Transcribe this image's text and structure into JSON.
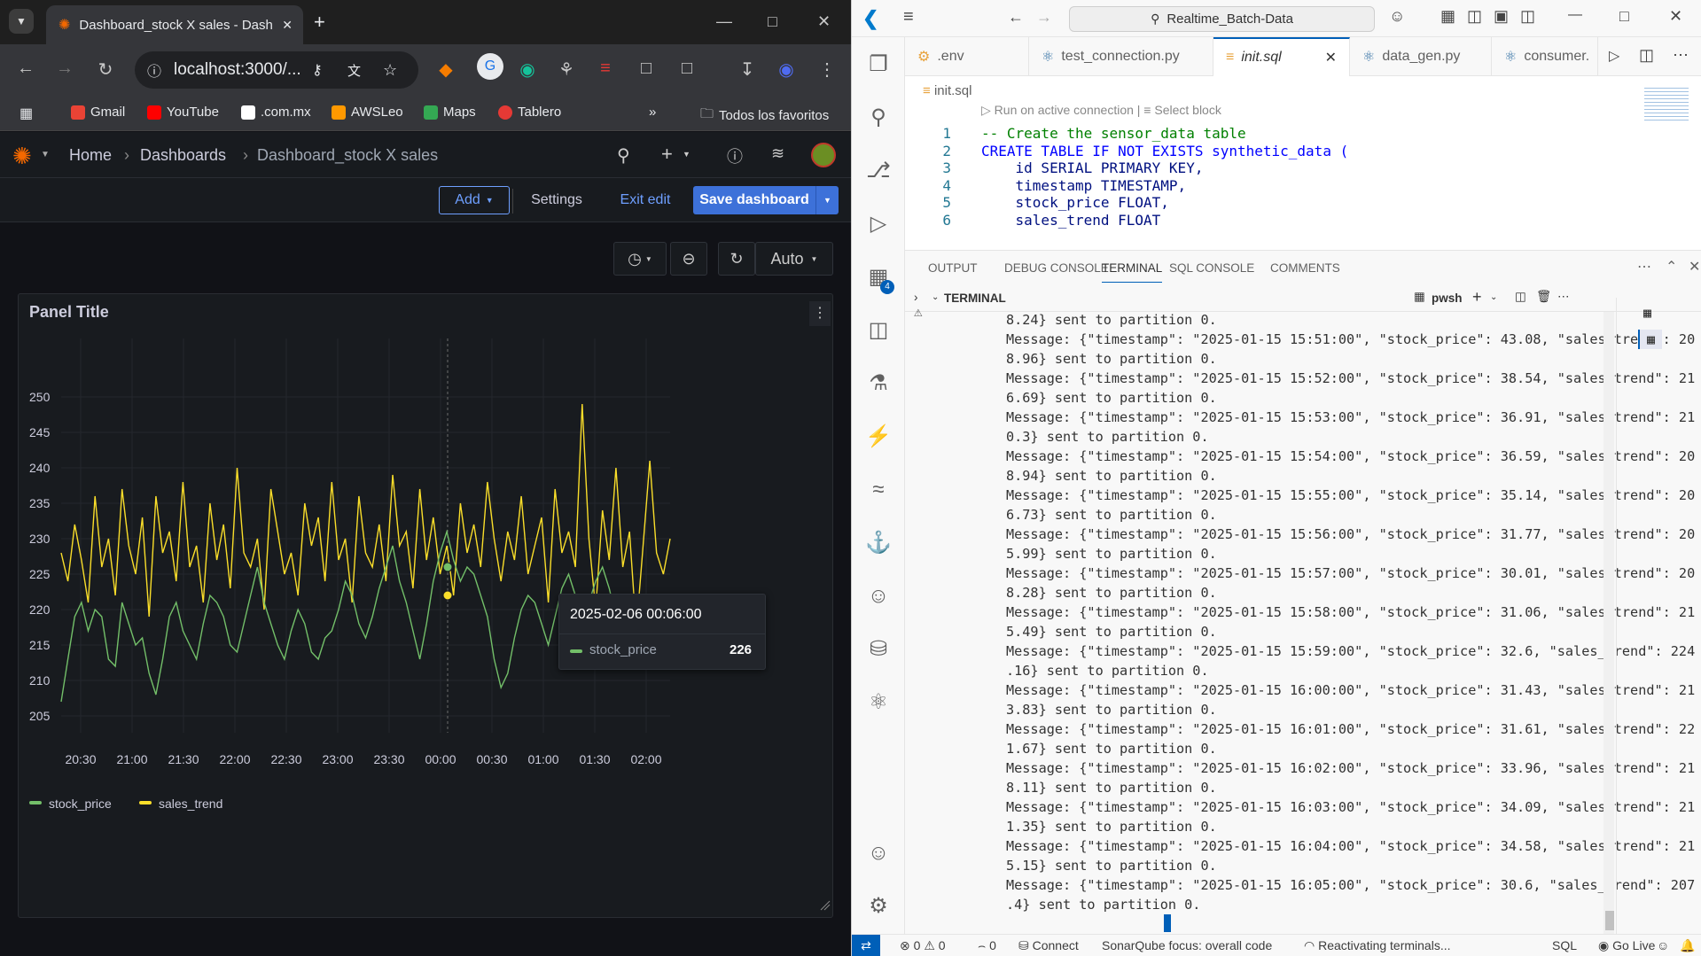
{
  "browser": {
    "tab_title": "Dashboard_stock X sales - Dash",
    "url": "localhost:3000/...",
    "bookmarks": [
      "Gmail",
      "YouTube",
      ".com.mx",
      "AWSLeo",
      "Maps",
      "Tablero"
    ],
    "all_bookmarks": "Todos los favoritos"
  },
  "grafana": {
    "breadcrumbs": [
      "Home",
      "Dashboards",
      "Dashboard_stock X sales"
    ],
    "add_label": "Add",
    "settings_label": "Settings",
    "exit_edit_label": "Exit edit",
    "save_label": "Save dashboard",
    "refresh_label": "Auto",
    "panel_title": "Panel Title",
    "tooltip": {
      "time": "2025-02-06 00:06:00",
      "series": "stock_price",
      "value": "226"
    }
  },
  "chart_data": {
    "type": "line",
    "x_ticks": [
      "20:30",
      "21:00",
      "21:30",
      "22:00",
      "22:30",
      "23:00",
      "23:30",
      "00:00",
      "00:30",
      "01:00",
      "01:30",
      "02:00"
    ],
    "y_ticks": [
      205,
      210,
      215,
      220,
      225,
      230,
      235,
      240,
      245,
      250
    ],
    "ylim": [
      203,
      253
    ],
    "legend_position": "bottom-left",
    "series": [
      {
        "name": "stock_price",
        "color": "#73bf69",
        "values": [
          207,
          213,
          219,
          221,
          217,
          220,
          219,
          213,
          212,
          221,
          218,
          215,
          216,
          211,
          208,
          213,
          219,
          221,
          217,
          215,
          213,
          218,
          222,
          221,
          219,
          215,
          214,
          218,
          222,
          226,
          221,
          218,
          215,
          213,
          217,
          220,
          218,
          214,
          213,
          216,
          217,
          220,
          224,
          222,
          218,
          216,
          219,
          223,
          226,
          229,
          224,
          221,
          217,
          213,
          218,
          224,
          228,
          231,
          227,
          224,
          226,
          225,
          222,
          219,
          213,
          209,
          211,
          216,
          220,
          222,
          221,
          218,
          215,
          219,
          223,
          225,
          222,
          218,
          221,
          224,
          226,
          223,
          219,
          221,
          218,
          220,
          215,
          214,
          212,
          215,
          216
        ]
      },
      {
        "name": "sales_trend",
        "color": "#fade2a",
        "values": [
          228,
          224,
          232,
          227,
          221,
          236,
          226,
          230,
          222,
          237,
          229,
          225,
          233,
          219,
          236,
          228,
          231,
          224,
          238,
          226,
          229,
          221,
          235,
          227,
          232,
          223,
          240,
          228,
          226,
          230,
          220,
          237,
          231,
          225,
          228,
          222,
          235,
          229,
          233,
          224,
          238,
          227,
          230,
          221,
          236,
          228,
          226,
          232,
          224,
          239,
          229,
          231,
          223,
          237,
          227,
          233,
          225,
          229,
          222,
          235,
          228,
          232,
          226,
          238,
          230,
          224,
          231,
          227,
          236,
          225,
          229,
          233,
          221,
          237,
          228,
          231,
          226,
          249,
          230,
          220,
          234,
          227,
          240,
          226,
          231,
          217,
          229,
          241,
          228,
          225,
          230
        ]
      }
    ]
  },
  "vscode": {
    "command_center": "Realtime_Batch-Data",
    "tabs": [
      ".env",
      "test_connection.py",
      "init.sql",
      "data_gen.py",
      "consumer."
    ],
    "breadcrumb": "init.sql",
    "codelens": "Run on active connection | ≡ Select block",
    "code": [
      {
        "n": "1",
        "text": "-- Create the sensor_data table"
      },
      {
        "n": "2",
        "text": "CREATE TABLE IF NOT EXISTS synthetic_data ("
      },
      {
        "n": "3",
        "text": "    id SERIAL PRIMARY KEY,"
      },
      {
        "n": "4",
        "text": "    timestamp TIMESTAMP,"
      },
      {
        "n": "5",
        "text": "    stock_price FLOAT,"
      },
      {
        "n": "6",
        "text": "    sales_trend FLOAT"
      }
    ],
    "panel_tabs": [
      "OUTPUT",
      "DEBUG CONSOLE",
      "TERMINAL",
      "SQL CONSOLE",
      "COMMENTS"
    ],
    "terminal_title": "TERMINAL",
    "shell": "pwsh",
    "terminal_lines": [
      "8.24} sent to partition 0.",
      "Message: {\"timestamp\": \"2025-01-15 15:51:00\", \"stock_price\": 43.08, \"sales_trend\": 20",
      "8.96} sent to partition 0.",
      "Message: {\"timestamp\": \"2025-01-15 15:52:00\", \"stock_price\": 38.54, \"sales_trend\": 21",
      "6.69} sent to partition 0.",
      "Message: {\"timestamp\": \"2025-01-15 15:53:00\", \"stock_price\": 36.91, \"sales_trend\": 21",
      "0.3} sent to partition 0.",
      "Message: {\"timestamp\": \"2025-01-15 15:54:00\", \"stock_price\": 36.59, \"sales_trend\": 20",
      "8.94} sent to partition 0.",
      "Message: {\"timestamp\": \"2025-01-15 15:55:00\", \"stock_price\": 35.14, \"sales_trend\": 20",
      "6.73} sent to partition 0.",
      "Message: {\"timestamp\": \"2025-01-15 15:56:00\", \"stock_price\": 31.77, \"sales_trend\": 20",
      "5.99} sent to partition 0.",
      "Message: {\"timestamp\": \"2025-01-15 15:57:00\", \"stock_price\": 30.01, \"sales_trend\": 20",
      "8.28} sent to partition 0.",
      "Message: {\"timestamp\": \"2025-01-15 15:58:00\", \"stock_price\": 31.06, \"sales_trend\": 21",
      "5.49} sent to partition 0.",
      "Message: {\"timestamp\": \"2025-01-15 15:59:00\", \"stock_price\": 32.6, \"sales_trend\": 224",
      ".16} sent to partition 0.",
      "Message: {\"timestamp\": \"2025-01-15 16:00:00\", \"stock_price\": 31.43, \"sales_trend\": 21",
      "3.83} sent to partition 0.",
      "Message: {\"timestamp\": \"2025-01-15 16:01:00\", \"stock_price\": 31.61, \"sales_trend\": 22",
      "1.67} sent to partition 0.",
      "Message: {\"timestamp\": \"2025-01-15 16:02:00\", \"stock_price\": 33.96, \"sales_trend\": 21",
      "8.11} sent to partition 0.",
      "Message: {\"timestamp\": \"2025-01-15 16:03:00\", \"stock_price\": 34.09, \"sales_trend\": 21",
      "1.35} sent to partition 0.",
      "Message: {\"timestamp\": \"2025-01-15 16:04:00\", \"stock_price\": 34.58, \"sales_trend\": 21",
      "5.15} sent to partition 0.",
      "Message: {\"timestamp\": \"2025-01-15 16:05:00\", \"stock_price\": 30.6, \"sales_trend\": 207",
      ".4} sent to partition 0."
    ],
    "status": {
      "problems": "0",
      "warnings": "0",
      "ports": "0",
      "connect": "Connect",
      "sonar": "SonarQube focus: overall code",
      "reactivating": "Reactivating terminals...",
      "language": "SQL",
      "golive": "Go Live"
    }
  }
}
